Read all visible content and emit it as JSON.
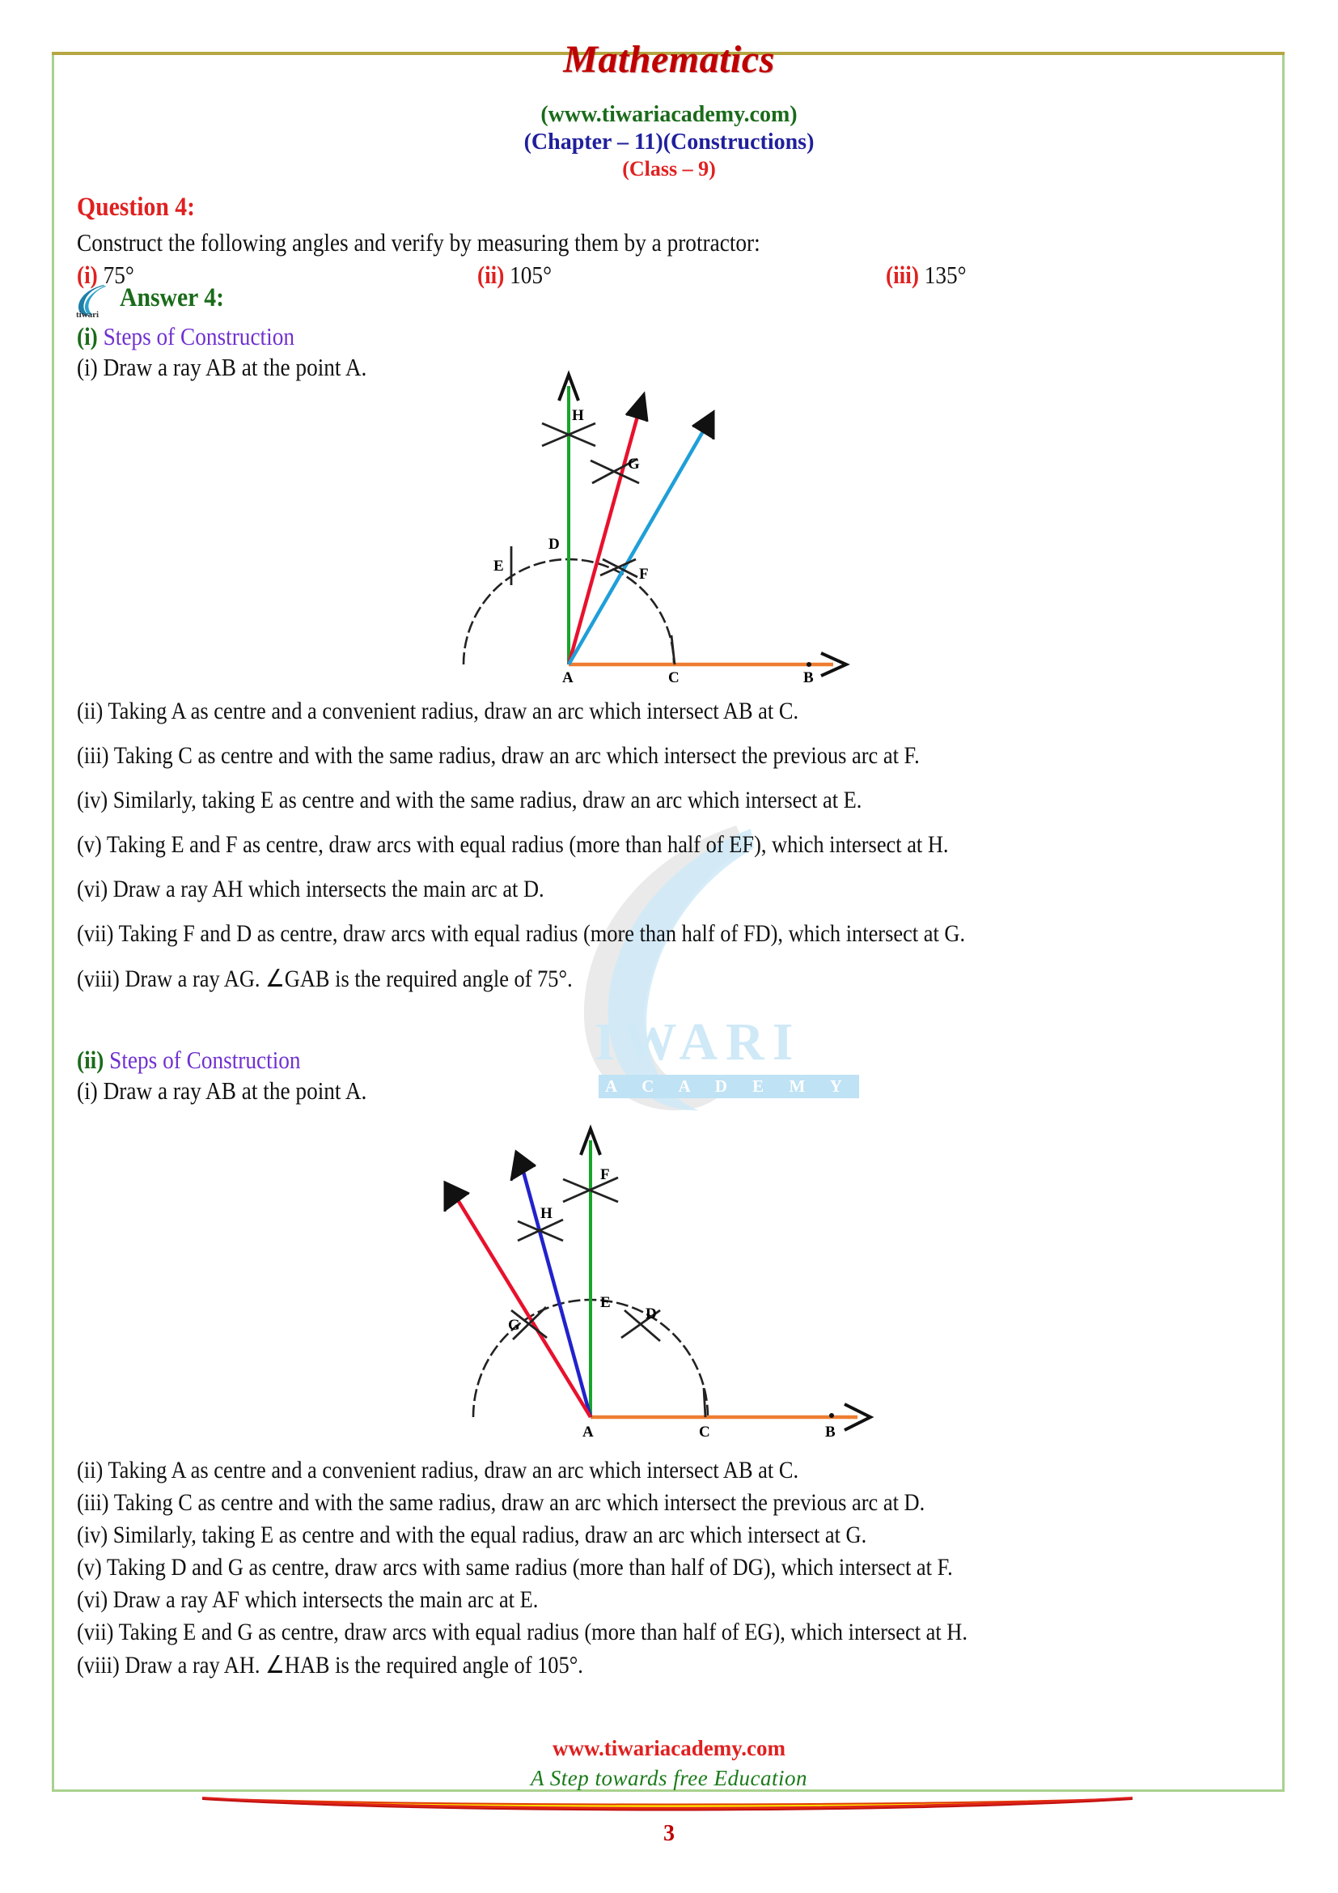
{
  "header": {
    "title": "Mathematics",
    "site": "(www.tiwariacademy.com)",
    "chapter": "(Chapter – 11)(Constructions)",
    "class": "(Class – 9)"
  },
  "question": {
    "heading": "Question 4:",
    "prompt": "Construct the following angles and verify by measuring them by a protractor:",
    "options": [
      {
        "roman": "(i)",
        "value": "75°"
      },
      {
        "roman": "(ii)",
        "value": "105°"
      },
      {
        "roman": "(iii)",
        "value": "135°"
      }
    ]
  },
  "answer": {
    "heading": "Answer 4:",
    "parts": [
      {
        "roman": "(i)",
        "steps_title": "Steps of Construction",
        "first_step": "(i) Draw a ray AB at the point A.",
        "steps": [
          "(ii) Taking A as centre and a convenient radius, draw an arc which intersect AB at C.",
          "(iii) Taking C as centre and with the same radius, draw an arc which intersect the previous arc at F.",
          "(iv) Similarly, taking E as centre and with the same radius, draw an arc which intersect at E.",
          "(v) Taking E and F as centre, draw arcs with equal radius (more than half of EF), which intersect at H.",
          "(vi) Draw a ray AH which intersects the main arc at D.",
          "(vii) Taking F and D as centre, draw arcs with equal radius (more than half of FD), which intersect at G.",
          "(viii) Draw a ray AG. ∠GAB is the required angle of 75°."
        ]
      },
      {
        "roman": "(ii)",
        "steps_title": "Steps of Construction",
        "first_step": "(i) Draw a ray AB at the point A.",
        "steps": [
          "(ii) Taking A as centre and a convenient radius, draw an arc which intersect AB at C.",
          "(iii) Taking C as centre and with the same radius, draw an arc which intersect the previous arc at D.",
          "(iv) Similarly, taking E as centre and with the equal radius, draw an arc which intersect at G.",
          "(v) Taking D and G as centre, draw arcs with same radius (more than half of DG), which intersect at F.",
          "(vi) Draw a ray AF which intersects the main arc at E.",
          "(vii) Taking E and G as centre, draw arcs with equal radius (more than half of EG), which intersect at H.",
          "(viii) Draw a ray AH.  ∠HAB is the required angle of 105°."
        ]
      }
    ]
  },
  "figures": [
    {
      "name": "construction-75-degrees",
      "points": [
        "A",
        "B",
        "C",
        "D",
        "E",
        "F",
        "G",
        "H"
      ],
      "rays": [
        {
          "label": "AB",
          "color": "#ED7D31"
        },
        {
          "label": "AH",
          "color": "#17a52a"
        },
        {
          "label": "AG",
          "color": "#e8112d"
        },
        {
          "label": "AF",
          "color": "#1f9fd8"
        }
      ]
    },
    {
      "name": "construction-105-degrees",
      "points": [
        "A",
        "B",
        "C",
        "D",
        "E",
        "F",
        "G",
        "H"
      ],
      "rays": [
        {
          "label": "AB",
          "color": "#ED7D31"
        },
        {
          "label": "AF",
          "color": "#17a52a"
        },
        {
          "label": "AH",
          "color": "#2222cc"
        },
        {
          "label": "AG",
          "color": "#e8112d"
        }
      ]
    }
  ],
  "watermark": {
    "text": "IWARI",
    "sub": "A C A D E M Y"
  },
  "footer": {
    "site": "www.tiwariacademy.com",
    "tagline": "A Step towards free Education",
    "page": "3"
  },
  "colors": {
    "heading_red": "#e02020",
    "green": "#1a6b1a",
    "blue": "#1f1f9c",
    "purple": "#7030d0",
    "border_green": "#a9d18e"
  }
}
